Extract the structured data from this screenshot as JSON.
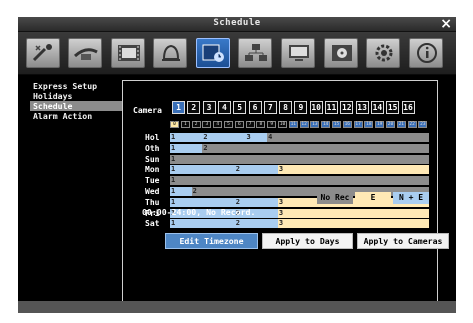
{
  "window": {
    "title": "Schedule",
    "close_icon": "×"
  },
  "toolbar": {
    "buttons": [
      {
        "icon": "settings-wizard-icon",
        "active": false
      },
      {
        "icon": "network-icon",
        "active": false
      },
      {
        "icon": "video-film-icon",
        "active": false
      },
      {
        "icon": "alarm-bell-icon",
        "active": false
      },
      {
        "icon": "schedule-icon",
        "active": true
      },
      {
        "icon": "devices-icon",
        "active": false
      },
      {
        "icon": "display-icon",
        "active": false
      },
      {
        "icon": "storage-icon",
        "active": false
      },
      {
        "icon": "system-gear-icon",
        "active": false
      },
      {
        "icon": "info-icon",
        "active": false
      }
    ]
  },
  "sidebar": {
    "items": [
      {
        "label": "Express Setup",
        "selected": false
      },
      {
        "label": "Holidays",
        "selected": false
      },
      {
        "label": "Schedule",
        "selected": true
      },
      {
        "label": "Alarm Action",
        "selected": false
      }
    ]
  },
  "camera": {
    "label": "Camera",
    "channels": [
      "1",
      "2",
      "3",
      "4",
      "5",
      "6",
      "7",
      "8",
      "9",
      "10",
      "11",
      "12",
      "13",
      "14",
      "15",
      "16"
    ],
    "selected": "1"
  },
  "hours": {
    "values": [
      "0",
      "1",
      "2",
      "3",
      "4",
      "5",
      "6",
      "7",
      "8",
      "9",
      "10",
      "11",
      "12",
      "13",
      "14",
      "15",
      "16",
      "17",
      "18",
      "19",
      "20",
      "21",
      "22",
      "23"
    ],
    "highlighted": [
      "0"
    ]
  },
  "schedule": {
    "days": [
      {
        "label": "Hol",
        "marks": [
          {
            "t": "1",
            "h": 0
          },
          {
            "t": "2",
            "h": 3
          },
          {
            "t": "3",
            "h": 7
          },
          {
            "t": "4",
            "h": 9
          }
        ]
      },
      {
        "label": "Oth",
        "marks": [
          {
            "t": "1",
            "h": 0
          },
          {
            "t": "2",
            "h": 3
          }
        ]
      },
      {
        "label": "Sun",
        "marks": [
          {
            "t": "1",
            "h": 0
          }
        ]
      },
      {
        "label": "Mon",
        "marks": [
          {
            "t": "1",
            "h": 0
          },
          {
            "t": "2",
            "h": 6
          },
          {
            "t": "3",
            "h": 10
          }
        ]
      },
      {
        "label": "Tue",
        "marks": [
          {
            "t": "1",
            "h": 0
          }
        ]
      },
      {
        "label": "Wed",
        "marks": [
          {
            "t": "1",
            "h": 0
          },
          {
            "t": "2",
            "h": 2
          }
        ]
      },
      {
        "label": "Thu",
        "marks": [
          {
            "t": "1",
            "h": 0
          },
          {
            "t": "2",
            "h": 6
          },
          {
            "t": "3",
            "h": 10
          }
        ]
      },
      {
        "label": "Fri",
        "marks": [
          {
            "t": "1",
            "h": 0
          },
          {
            "t": "2",
            "h": 6
          },
          {
            "t": "3",
            "h": 10
          }
        ]
      },
      {
        "label": "Sat",
        "marks": [
          {
            "t": "1",
            "h": 0
          },
          {
            "t": "2",
            "h": 6
          },
          {
            "t": "3",
            "h": 10
          }
        ]
      }
    ]
  },
  "legend": {
    "items": [
      {
        "label": "No Rec",
        "color": "#8c8c8c"
      },
      {
        "label": "E",
        "color": "#ffe9b5"
      },
      {
        "label": "N + E",
        "color": "#a9cdf0"
      }
    ]
  },
  "status_text": "00:00-24:00, No Record.",
  "buttons": {
    "edit_timezone": "Edit Timezone",
    "apply_days": "Apply to Days",
    "apply_cameras": "Apply to Cameras"
  },
  "colors": {
    "accent": "#3a6fb7",
    "normal_event": "#a9cdf0",
    "event": "#ffe9b5",
    "no_record": "#8c8c8c"
  }
}
